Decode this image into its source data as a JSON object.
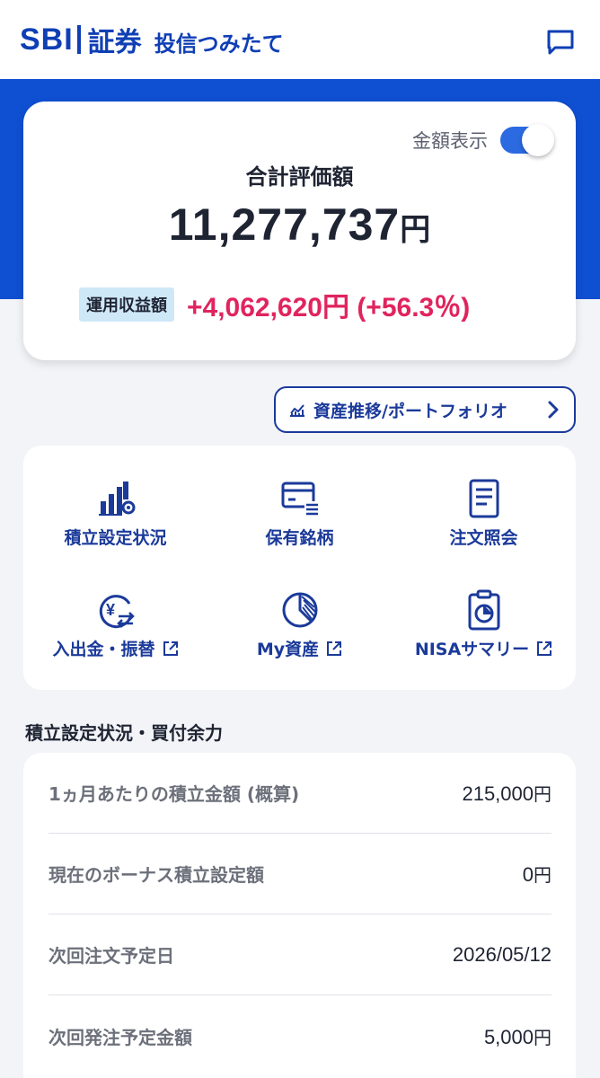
{
  "header": {
    "logo_sbi": "SBI",
    "logo_shoken": "証券",
    "subtitle": "投信つみたて",
    "chat_icon": "chat-bubble-icon"
  },
  "summary": {
    "toggle_label": "金額表示",
    "toggle_on": true,
    "total_label": "合計評価額",
    "total_amount": "11,277,737",
    "total_unit": "円",
    "profit_badge": "運用収益額",
    "profit_value": "+4,062,620円 (+56.3％)"
  },
  "trend_button": {
    "label": "資産推移/ポートフォリオ",
    "icon": "chart-trend-icon"
  },
  "menu": {
    "items": [
      {
        "label": "積立設定状況",
        "icon": "bar-chart-settings-icon"
      },
      {
        "label": "保有銘柄",
        "icon": "card-list-icon"
      },
      {
        "label": "注文照会",
        "icon": "document-icon"
      },
      {
        "label": "入出金・振替",
        "icon": "yen-exchange-icon"
      },
      {
        "label": "My資産",
        "icon": "pie-chart-icon"
      },
      {
        "label": "NISAサマリー",
        "icon": "clipboard-chart-icon"
      }
    ]
  },
  "section": {
    "title": "積立設定状況・買付余力"
  },
  "info_rows": [
    {
      "label": "1ヵ月あたりの積立金額 (概算)",
      "value": "215,000",
      "unit": "円"
    },
    {
      "label": "現在のボーナス積立設定額",
      "value": "0",
      "unit": "円"
    },
    {
      "label": "次回注文予定日",
      "value": "2026/05/12",
      "unit": ""
    },
    {
      "label": "次回発注予定金額",
      "value": "5,000",
      "unit": "円"
    }
  ],
  "colors": {
    "brand_blue": "#0f3fb5",
    "band_blue": "#0f4fd1",
    "profit_red": "#e0245e",
    "menu_blue": "#1b3a9a"
  }
}
